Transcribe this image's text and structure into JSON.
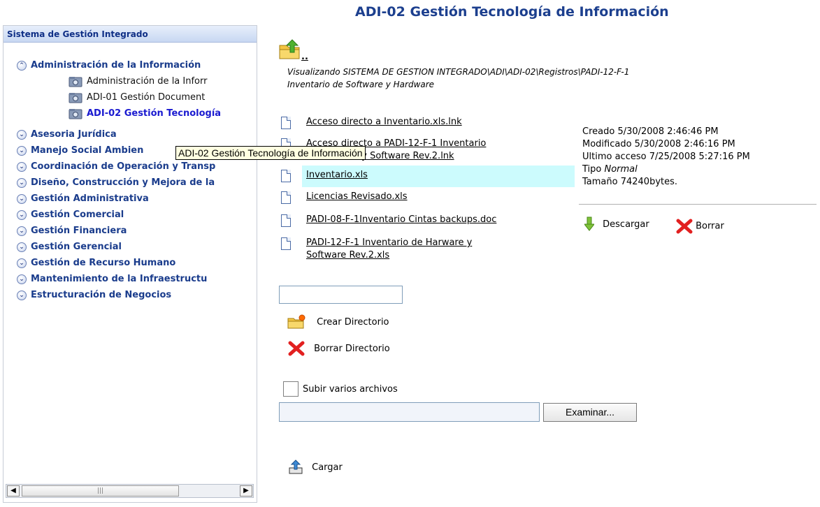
{
  "title": "ADI-02 Gestión Tecnología de Información",
  "panel": {
    "header": "Sistema de Gestión Integrado",
    "tree": [
      {
        "label": "Administración de la Información",
        "expanded": true,
        "children": [
          {
            "label": "Administración de la Inforr",
            "selected": false
          },
          {
            "label": "ADI-01 Gestión Document",
            "selected": false
          },
          {
            "label": "ADI-02 Gestión Tecnología",
            "selected": true
          }
        ]
      },
      {
        "label": "Asesoria Jurídica"
      },
      {
        "label": "Manejo Social Ambien"
      },
      {
        "label": "Coordinación de Operación y Transp"
      },
      {
        "label": "Diseño, Construcción y Mejora de la"
      },
      {
        "label": "Gestión Administrativa"
      },
      {
        "label": "Gestión Comercial"
      },
      {
        "label": "Gestión Financiera"
      },
      {
        "label": "Gestión Gerencial"
      },
      {
        "label": "Gestión de Recurso Humano"
      },
      {
        "label": "Mantenimiento de la Infraestructu"
      },
      {
        "label": "Estructuración de Negocios"
      }
    ],
    "tooltip": "ADI-02 Gestión Tecnología de Información"
  },
  "browser": {
    "up_label": "..",
    "path_line1": "Visualizando SISTEMA DE GESTION INTEGRADO\\ADI\\ADI-02\\Registros\\PADI-12-F-1",
    "path_line2": "Inventario de Software y Hardware",
    "files": [
      {
        "name": "Acceso directo a Inventario.xls.lnk"
      },
      {
        "name_line1": "Acceso directo a PADI-12-F-1 Inventario",
        "name_line2": "de Harware y Software Rev.2.lnk"
      },
      {
        "name": "Inventario.xls",
        "selected": true
      },
      {
        "name": "Licencias Revisado.xls"
      },
      {
        "name": "PADI-08-F-1Inventario Cintas backups.doc"
      },
      {
        "name_line1": "PADI-12-F-1 Inventario de Harware y",
        "name_line2": "Software Rev.2.xls"
      }
    ],
    "info": {
      "created": "Creado 5/30/2008 2:46:46 PM",
      "modified": "Modificado 5/30/2008 2:46:16 PM",
      "accessed": "Ultimo acceso 7/25/2008 5:27:16 PM",
      "type_label": "Tipo",
      "type_value": "Normal",
      "size": "Tamaño 74240bytes."
    },
    "download_label": "Descargar",
    "delete_label": "Borrar",
    "create_dir_label": "Crear Directorio",
    "delete_dir_label": "Borrar Directorio",
    "multi_upload_label": "Subir varios archivos",
    "browse_label": "Examinar...",
    "upload_label": "Cargar"
  }
}
